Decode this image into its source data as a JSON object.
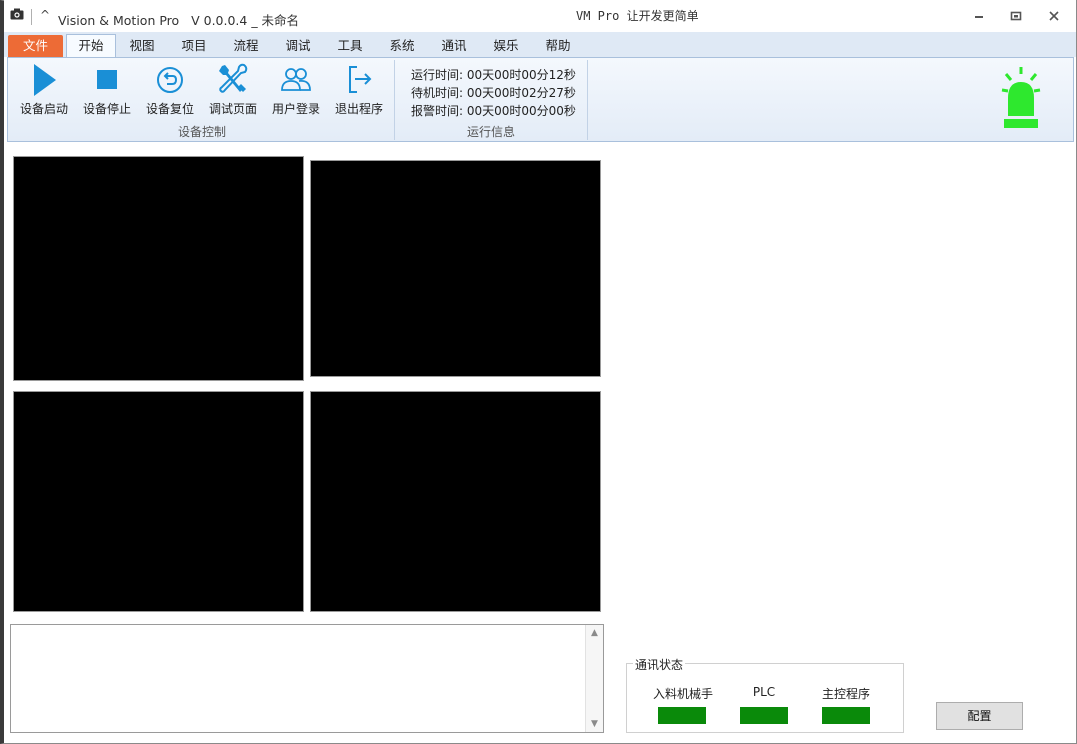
{
  "window": {
    "app_title": "Vision & Motion Pro   V 0.0.0.4 _ 未命名",
    "center_title": "VM Pro 让开发更简单",
    "caret": "^"
  },
  "tabs": [
    {
      "label": "文件"
    },
    {
      "label": "开始"
    },
    {
      "label": "视图"
    },
    {
      "label": "项目"
    },
    {
      "label": "流程"
    },
    {
      "label": "调试"
    },
    {
      "label": "工具"
    },
    {
      "label": "系统"
    },
    {
      "label": "通讯"
    },
    {
      "label": "娱乐"
    },
    {
      "label": "帮助"
    }
  ],
  "ribbon": {
    "buttons": [
      {
        "label": "设备启动",
        "icon": "play-icon"
      },
      {
        "label": "设备停止",
        "icon": "stop-icon"
      },
      {
        "label": "设备复位",
        "icon": "reset-icon"
      },
      {
        "label": "调试页面",
        "icon": "tools-icon"
      },
      {
        "label": "用户登录",
        "icon": "users-icon"
      },
      {
        "label": "退出程序",
        "icon": "exit-icon"
      }
    ],
    "group_device": "设备控制",
    "group_info": "运行信息",
    "run_info": {
      "running": "运行时间: 00天00时00分12秒",
      "standby": "待机时间: 00天00时02分27秒",
      "alarm": "报警时间: 00天00时00分00秒"
    },
    "accent_color": "#1a8fd6",
    "alarm_color": "#2ee82e"
  },
  "comm_status": {
    "title": "通讯状态",
    "devices": [
      {
        "label": "入料机械手",
        "status_color": "#0a8a0a"
      },
      {
        "label": "PLC",
        "status_color": "#0a8a0a"
      },
      {
        "label": "主控程序",
        "status_color": "#0a8a0a"
      }
    ]
  },
  "config_button": "配置"
}
